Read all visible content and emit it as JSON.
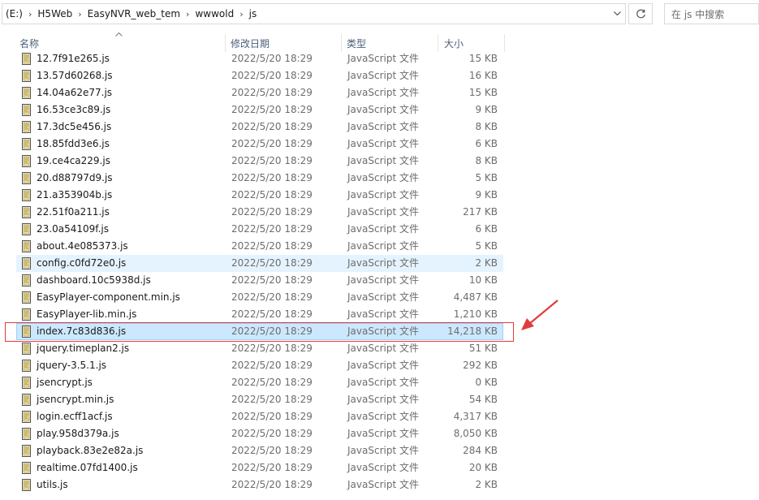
{
  "address": {
    "crumbs": [
      "(E:)",
      "H5Web",
      "EasyNVR_web_tem",
      "wwwold",
      "js"
    ],
    "separator": "›"
  },
  "search": {
    "placeholder": "在 js 中搜索"
  },
  "columns": {
    "name": "名称",
    "date": "修改日期",
    "type": "类型",
    "size": "大小"
  },
  "files": [
    {
      "name": "12.7f91e265.js",
      "date": "2022/5/20 18:29",
      "type": "JavaScript 文件",
      "size": "15 KB"
    },
    {
      "name": "13.57d60268.js",
      "date": "2022/5/20 18:29",
      "type": "JavaScript 文件",
      "size": "16 KB"
    },
    {
      "name": "14.04a62e77.js",
      "date": "2022/5/20 18:29",
      "type": "JavaScript 文件",
      "size": "15 KB"
    },
    {
      "name": "16.53ce3c89.js",
      "date": "2022/5/20 18:29",
      "type": "JavaScript 文件",
      "size": "9 KB"
    },
    {
      "name": "17.3dc5e456.js",
      "date": "2022/5/20 18:29",
      "type": "JavaScript 文件",
      "size": "8 KB"
    },
    {
      "name": "18.85fdd3e6.js",
      "date": "2022/5/20 18:29",
      "type": "JavaScript 文件",
      "size": "6 KB"
    },
    {
      "name": "19.ce4ca229.js",
      "date": "2022/5/20 18:29",
      "type": "JavaScript 文件",
      "size": "8 KB"
    },
    {
      "name": "20.d88797d9.js",
      "date": "2022/5/20 18:29",
      "type": "JavaScript 文件",
      "size": "5 KB"
    },
    {
      "name": "21.a353904b.js",
      "date": "2022/5/20 18:29",
      "type": "JavaScript 文件",
      "size": "9 KB"
    },
    {
      "name": "22.51f0a211.js",
      "date": "2022/5/20 18:29",
      "type": "JavaScript 文件",
      "size": "217 KB"
    },
    {
      "name": "23.0a54109f.js",
      "date": "2022/5/20 18:29",
      "type": "JavaScript 文件",
      "size": "6 KB"
    },
    {
      "name": "about.4e085373.js",
      "date": "2022/5/20 18:29",
      "type": "JavaScript 文件",
      "size": "5 KB"
    },
    {
      "name": "config.c0fd72e0.js",
      "date": "2022/5/20 18:29",
      "type": "JavaScript 文件",
      "size": "2 KB",
      "state": "hover"
    },
    {
      "name": "dashboard.10c5938d.js",
      "date": "2022/5/20 18:29",
      "type": "JavaScript 文件",
      "size": "10 KB"
    },
    {
      "name": "EasyPlayer-component.min.js",
      "date": "2022/5/20 18:29",
      "type": "JavaScript 文件",
      "size": "4,487 KB"
    },
    {
      "name": "EasyPlayer-lib.min.js",
      "date": "2022/5/20 18:29",
      "type": "JavaScript 文件",
      "size": "1,210 KB"
    },
    {
      "name": "index.7c83d836.js",
      "date": "2022/5/20 18:29",
      "type": "JavaScript 文件",
      "size": "14,218 KB",
      "state": "selected"
    },
    {
      "name": "jquery.timeplan2.js",
      "date": "2022/5/20 18:29",
      "type": "JavaScript 文件",
      "size": "51 KB"
    },
    {
      "name": "jquery-3.5.1.js",
      "date": "2022/5/20 18:29",
      "type": "JavaScript 文件",
      "size": "292 KB"
    },
    {
      "name": "jsencrypt.js",
      "date": "2022/5/20 18:29",
      "type": "JavaScript 文件",
      "size": "0 KB"
    },
    {
      "name": "jsencrypt.min.js",
      "date": "2022/5/20 18:29",
      "type": "JavaScript 文件",
      "size": "54 KB"
    },
    {
      "name": "login.ecff1acf.js",
      "date": "2022/5/20 18:29",
      "type": "JavaScript 文件",
      "size": "4,317 KB"
    },
    {
      "name": "play.958d379a.js",
      "date": "2022/5/20 18:29",
      "type": "JavaScript 文件",
      "size": "8,050 KB"
    },
    {
      "name": "playback.83e2e82a.js",
      "date": "2022/5/20 18:29",
      "type": "JavaScript 文件",
      "size": "284 KB"
    },
    {
      "name": "realtime.07fd1400.js",
      "date": "2022/5/20 18:29",
      "type": "JavaScript 文件",
      "size": "20 KB"
    },
    {
      "name": "utils.js",
      "date": "2022/5/20 18:29",
      "type": "JavaScript 文件",
      "size": "2 KB"
    }
  ],
  "colors": {
    "selected": "#cce8ff",
    "hover": "#e5f3ff",
    "annotation": "#e23b3b"
  },
  "icons": {
    "file": "js-file-icon",
    "refresh": "refresh-icon",
    "dropdown": "chevron-down-icon",
    "annotation_arrow": "red-arrow-annotation"
  }
}
